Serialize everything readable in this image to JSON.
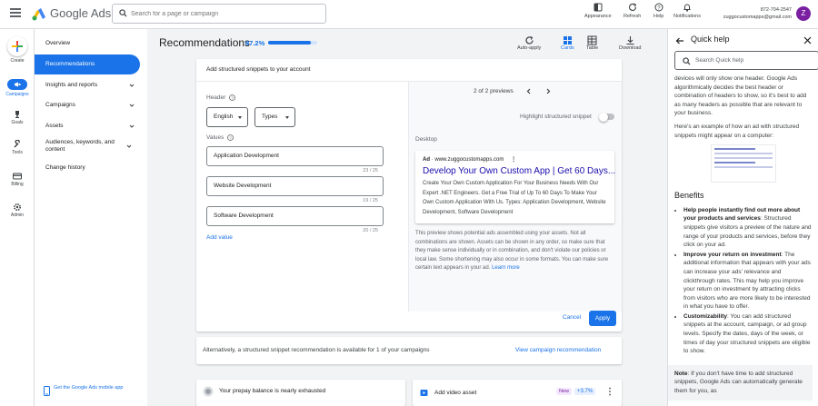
{
  "app": {
    "brand": "Google Ads"
  },
  "search": {
    "placeholder": "Search for a page or campaign"
  },
  "toolbar": {
    "appearance": "Appearance",
    "refresh": "Refresh",
    "help": "Help",
    "notifications": "Notifications"
  },
  "account": {
    "id": "872-704-2547",
    "email": "zuggocustomapps@gmail.com",
    "avatar_letter": "Z"
  },
  "rail": {
    "create": "Create",
    "campaigns": "Campaigns",
    "goals": "Goals",
    "tools": "Tools",
    "billing": "Billing",
    "admin": "Admin"
  },
  "nav": {
    "overview": "Overview",
    "recommendations": "Recommendations",
    "insights": "Insights and reports",
    "campaigns": "Campaigns",
    "assets": "Assets",
    "audiences": "Audiences, keywords, and content",
    "change_history": "Change history",
    "mobile_app": "Get the Google Ads mobile app"
  },
  "page": {
    "title": "Recommendations",
    "score": "87.2%",
    "score_fraction": 0.872,
    "auto_apply": "Auto-apply",
    "cards": "Cards",
    "table": "Table",
    "download": "Download"
  },
  "dialog": {
    "title": "Add structured snippets to your account",
    "header_label": "Header",
    "language": "English",
    "types": "Types",
    "values_label": "Values",
    "values": [
      {
        "text": "Application Development",
        "count": "23 / 25"
      },
      {
        "text": "Website Development",
        "count": "19 / 25"
      },
      {
        "text": "Software Development",
        "count": "20 / 25"
      }
    ],
    "add_value": "Add value",
    "cancel": "Cancel",
    "apply": "Apply"
  },
  "preview": {
    "pager": "2 of 2 previews",
    "highlight": "Highlight structured snippet",
    "desktop": "Desktop",
    "ad_label": "Ad",
    "ad_url": "www.zuggocustomapps.com",
    "ad_title": "Develop Your Own Custom App | Get 60 Days...",
    "ad_desc": "Create Your Own Custom Application For Your Business Needs With Our Expert .NET Engineers. Get a Free Trial of Up To 60 Days To Make Your Own Custom Application With Us. Types: Application Development, Website Development, Software Development",
    "note": "This preview shows potential ads assembled using your assets. Not all combinations are shown. Assets can be shown in any order, so make sure that they make sense individually or in combination, and don't violate our policies or local law. Some shortening may also occur in some formats. You can make sure certain text appears in your ad.",
    "learn_more": "Learn more"
  },
  "alt": {
    "text": "Alternatively, a structured snippet recommendation is available for 1 of your campaigns",
    "link": "View campaign recommendation"
  },
  "bottom": {
    "prepay": "Your prepay balance is nearly exhausted",
    "video": "Add video asset",
    "new_badge": "New",
    "uplift": "+3.7%"
  },
  "help": {
    "title": "Quick help",
    "search_placeholder": "Search Quick help",
    "intro": "devices will only show one header. Google Ads algorithmically decides the best header or combination of headers to show, so it's best to add as many headers as possible that are relevant to your business.",
    "example": "Here's an example of how an ad with structured snippets might appear on a computer:",
    "benefits_title": "Benefits",
    "b1_title": "Help people instantly find out more about your products and services",
    "b1_text": ": Structured snippets give visitors a preview of the nature and range of your products and services, before they click on your ad.",
    "b2_title": "Improve your return on investment",
    "b2_text": ": The additional information that appears with your ads can increase your ads' relevance and clickthrough rates. This may help you improve your return on investment by attracting clicks from visitors who are more likely to be interested in what you have to offer.",
    "b3_title": "Customizability",
    "b3_text": ": You can add structured snippets at the account, campaign, or ad group levels. Specify the dates, days of the week, or times of day your structured snippets are eligible to show.",
    "note_title": "Note",
    "note_text": ": If you don't have time to add structured snippets, Google Ads can automatically generate them for you, as"
  }
}
